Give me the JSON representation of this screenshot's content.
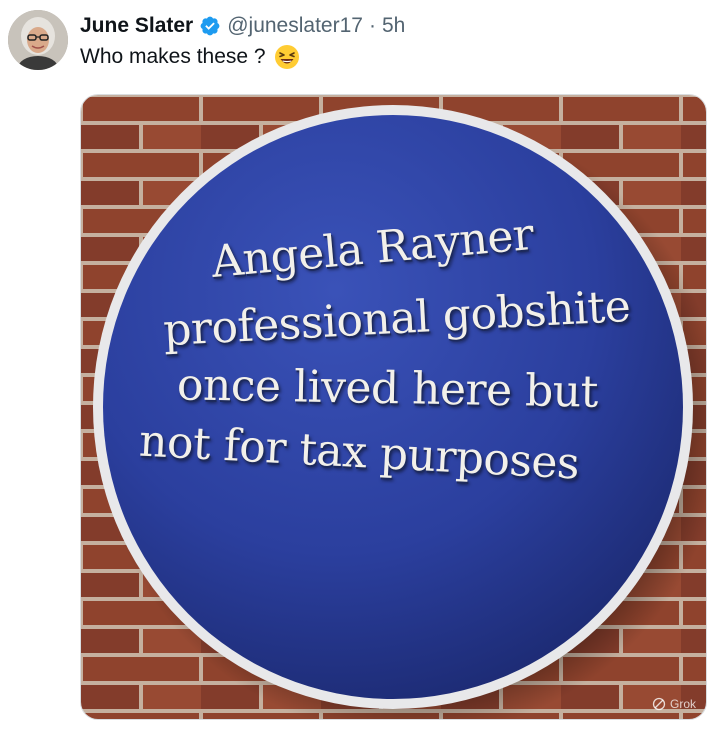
{
  "tweet": {
    "author": {
      "display_name": "June Slater",
      "handle": "@juneslater17",
      "verified": true,
      "avatar_icon": "profile-photo"
    },
    "separator": "·",
    "time": "5h",
    "text": "Who makes these ?",
    "emoji": "laughing-face",
    "media": {
      "plaque_lines": [
        "Angela Rayner",
        "professional gobshite",
        "once lived here but",
        "not for tax purposes"
      ],
      "watermark": "Grok"
    }
  },
  "colors": {
    "verified_badge": "#1d9bf0",
    "plaque_blue": "#2b3f9e",
    "brick": "#9b4a33",
    "secondary_text": "#536471",
    "primary_text": "#0f1419"
  }
}
